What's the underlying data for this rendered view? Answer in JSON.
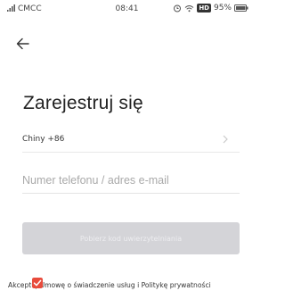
{
  "status_bar": {
    "carrier": "CMCC",
    "time": "08:41",
    "hd_badge": "HD",
    "battery": "95%",
    "icons": [
      "signal-icon",
      "alarm-icon",
      "wifi-icon",
      "battery-icon"
    ]
  },
  "nav": {
    "back_icon": "arrow-left-icon"
  },
  "title": "Zarejestruj się",
  "region": {
    "label": "Chiny +86",
    "chevron_icon": "chevron-right-icon"
  },
  "phone_field": {
    "placeholder": "Numer telefonu / adres e-mail",
    "value": ""
  },
  "verify_button": {
    "label": "Pobierz kod uwierzytelniania",
    "enabled": false
  },
  "consent": {
    "text": "Akceptuj Umowę o świadczenie usług i Politykę prywatności",
    "checked": true,
    "check_color": "#e84b3c"
  },
  "colors": {
    "button_disabled": "#d4d4d8",
    "title": "#222222",
    "placeholder": "#a9a9a9"
  }
}
